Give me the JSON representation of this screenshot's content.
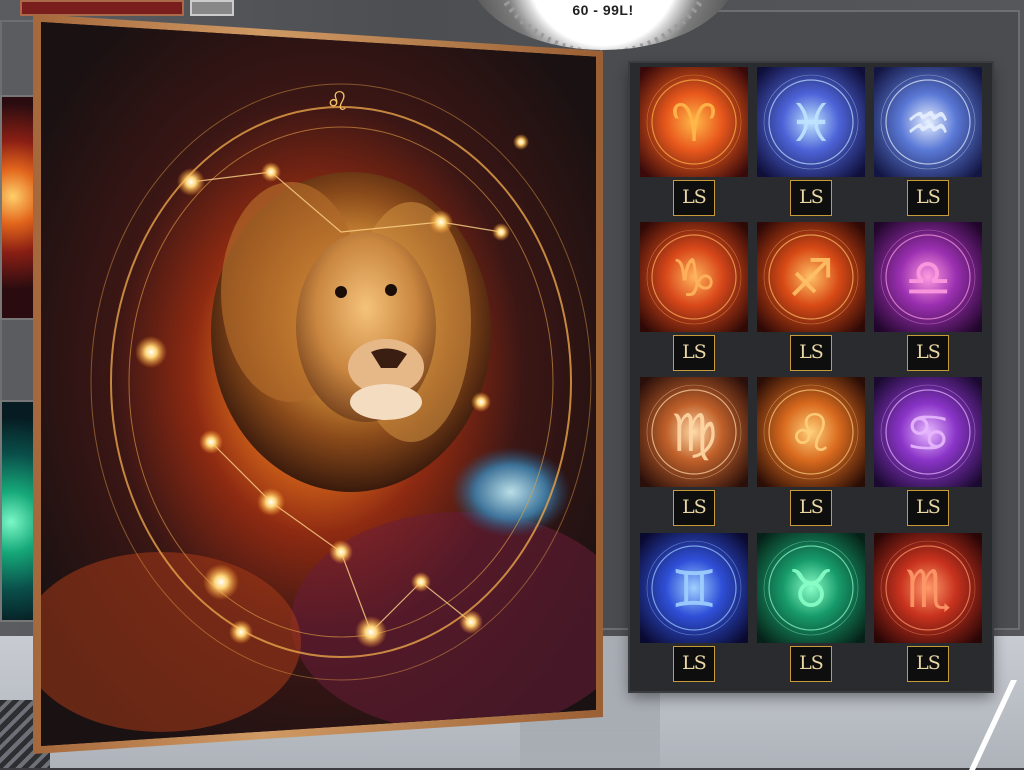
{
  "sale_badge": {
    "text": "60 - 99L!"
  },
  "poster": {
    "sign": "Leo",
    "zodiac_glyph": "♌"
  },
  "vendor": {
    "brand": "LS",
    "tiles": [
      {
        "sign": "Aries",
        "icon": "ram-icon",
        "glyph": "♈",
        "bg": "#e8581c",
        "glow": "#ffb84a",
        "dark": "#3a0a0a"
      },
      {
        "sign": "Pisces",
        "icon": "fish-icon",
        "glyph": "♓",
        "bg": "#4d63d8",
        "glow": "#bfe4ff",
        "dark": "#0f0f3a"
      },
      {
        "sign": "Aquarius",
        "icon": "water-bearer-icon",
        "glyph": "♒",
        "bg": "#5a78d6",
        "glow": "#e7f0ff",
        "dark": "#131643"
      },
      {
        "sign": "Capricorn",
        "icon": "goat-icon",
        "glyph": "♑",
        "bg": "#d9481a",
        "glow": "#ffb35c",
        "dark": "#2e0906"
      },
      {
        "sign": "Sagittarius",
        "icon": "archer-icon",
        "glyph": "♐",
        "bg": "#d84a16",
        "glow": "#ffc165",
        "dark": "#2e0906"
      },
      {
        "sign": "Libra",
        "icon": "scales-icon",
        "glyph": "♎",
        "bg": "#9a2fb0",
        "glow": "#ff9ae0",
        "dark": "#21062b"
      },
      {
        "sign": "Virgo",
        "icon": "maiden-icon",
        "glyph": "♍",
        "bg": "#c0602a",
        "glow": "#ffd9a6",
        "dark": "#2a0f0a"
      },
      {
        "sign": "Leo",
        "icon": "lion-icon",
        "glyph": "♌",
        "bg": "#d96a1e",
        "glow": "#ffcf7a",
        "dark": "#2a0d06"
      },
      {
        "sign": "Cancer",
        "icon": "crab-icon",
        "glyph": "♋",
        "bg": "#8a34c8",
        "glow": "#e8b8ff",
        "dark": "#1a0a30"
      },
      {
        "sign": "Gemini",
        "icon": "twins-icon",
        "glyph": "♊",
        "bg": "#2f4fd8",
        "glow": "#9fd0ff",
        "dark": "#0a0a30"
      },
      {
        "sign": "Taurus",
        "icon": "bull-icon",
        "glyph": "♉",
        "bg": "#179a6a",
        "glow": "#8affc8",
        "dark": "#062218"
      },
      {
        "sign": "Scorpio",
        "icon": "scorpion-icon",
        "glyph": "♏",
        "bg": "#c8321e",
        "glow": "#ff9a6a",
        "dark": "#2a0606"
      }
    ]
  }
}
